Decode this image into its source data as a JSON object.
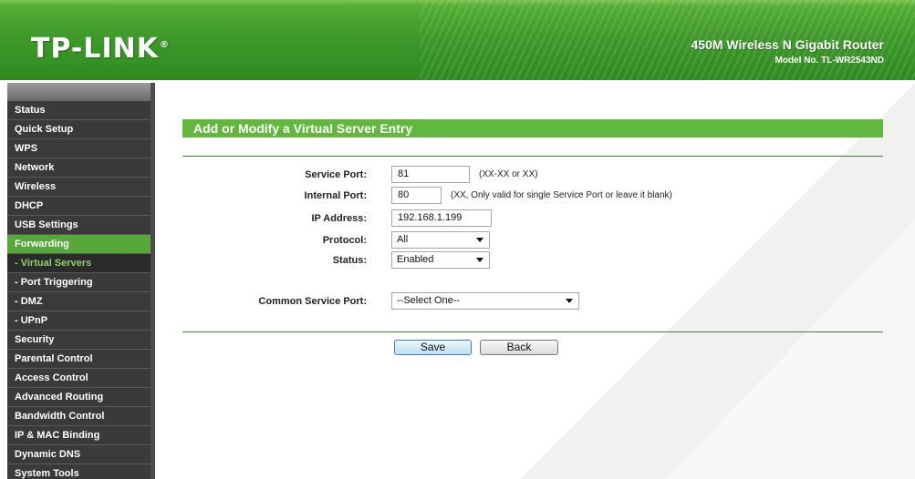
{
  "header": {
    "logo": "TP-LINK",
    "logo_reg": "®",
    "product_name": "450M Wireless N Gigabit Router",
    "model_no": "Model No. TL-WR2543ND"
  },
  "sidebar": {
    "items": [
      {
        "label": "Status"
      },
      {
        "label": "Quick Setup"
      },
      {
        "label": "WPS"
      },
      {
        "label": "Network"
      },
      {
        "label": "Wireless"
      },
      {
        "label": "DHCP"
      },
      {
        "label": "USB Settings"
      },
      {
        "label": "Forwarding"
      },
      {
        "label": "- Virtual Servers"
      },
      {
        "label": "- Port Triggering"
      },
      {
        "label": "- DMZ"
      },
      {
        "label": "- UPnP"
      },
      {
        "label": "Security"
      },
      {
        "label": "Parental Control"
      },
      {
        "label": "Access Control"
      },
      {
        "label": "Advanced Routing"
      },
      {
        "label": "Bandwidth Control"
      },
      {
        "label": "IP & MAC Binding"
      },
      {
        "label": "Dynamic DNS"
      },
      {
        "label": "System Tools"
      }
    ]
  },
  "form": {
    "title": "Add or Modify a Virtual Server Entry",
    "service_port_label": "Service Port:",
    "service_port_value": "81",
    "service_port_hint": "(XX-XX or XX)",
    "internal_port_label": "Internal Port:",
    "internal_port_value": "80",
    "internal_port_hint": "(XX, Only valid for single Service Port or leave it blank)",
    "ip_label": "IP Address:",
    "ip_value": "192.168.1.199",
    "protocol_label": "Protocol:",
    "protocol_value": "All",
    "status_label": "Status:",
    "status_value": "Enabled",
    "common_port_label": "Common Service Port:",
    "common_port_value": "--Select One--",
    "save_label": "Save",
    "back_label": "Back"
  },
  "colors": {
    "accent_green": "#62b83c",
    "sidebar_bg": "#3a3a3a",
    "active_sub_text": "#8fd06a"
  }
}
